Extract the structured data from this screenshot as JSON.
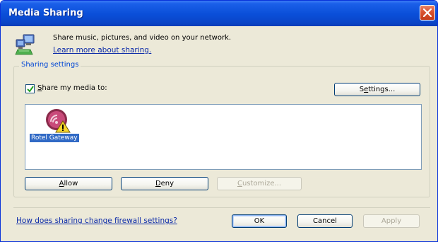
{
  "window": {
    "title": "Media Sharing"
  },
  "intro": {
    "description": "Share music, pictures, and video on your network.",
    "learn_more_link": "Learn more about sharing."
  },
  "sharing_settings": {
    "legend": "Sharing settings",
    "share_checkbox_checked": true,
    "share_label_access_key": "S",
    "share_label_rest": "hare my media to:",
    "settings_button_prefix": "S",
    "settings_button_access_key": "e",
    "settings_button_suffix": "ttings...",
    "devices": [
      {
        "name": "Rotel Gateway",
        "icon": "media-device-warning-icon",
        "selected": true
      }
    ],
    "allow_button_access_key": "A",
    "allow_button_rest": "llow",
    "deny_button_access_key": "D",
    "deny_button_rest": "eny",
    "customize_button_access_key": "C",
    "customize_button_rest": "ustomize..."
  },
  "footer": {
    "firewall_link": "How does sharing change firewall settings?",
    "ok_label": "OK",
    "cancel_label": "Cancel",
    "apply_label": "Apply"
  },
  "colors": {
    "titlebar": "#0A4ED8",
    "dialog_bg": "#ECE9D8",
    "link": "#0B2AA8",
    "legend": "#0046D5",
    "selection": "#316AC5",
    "close_button": "#D9522F"
  }
}
